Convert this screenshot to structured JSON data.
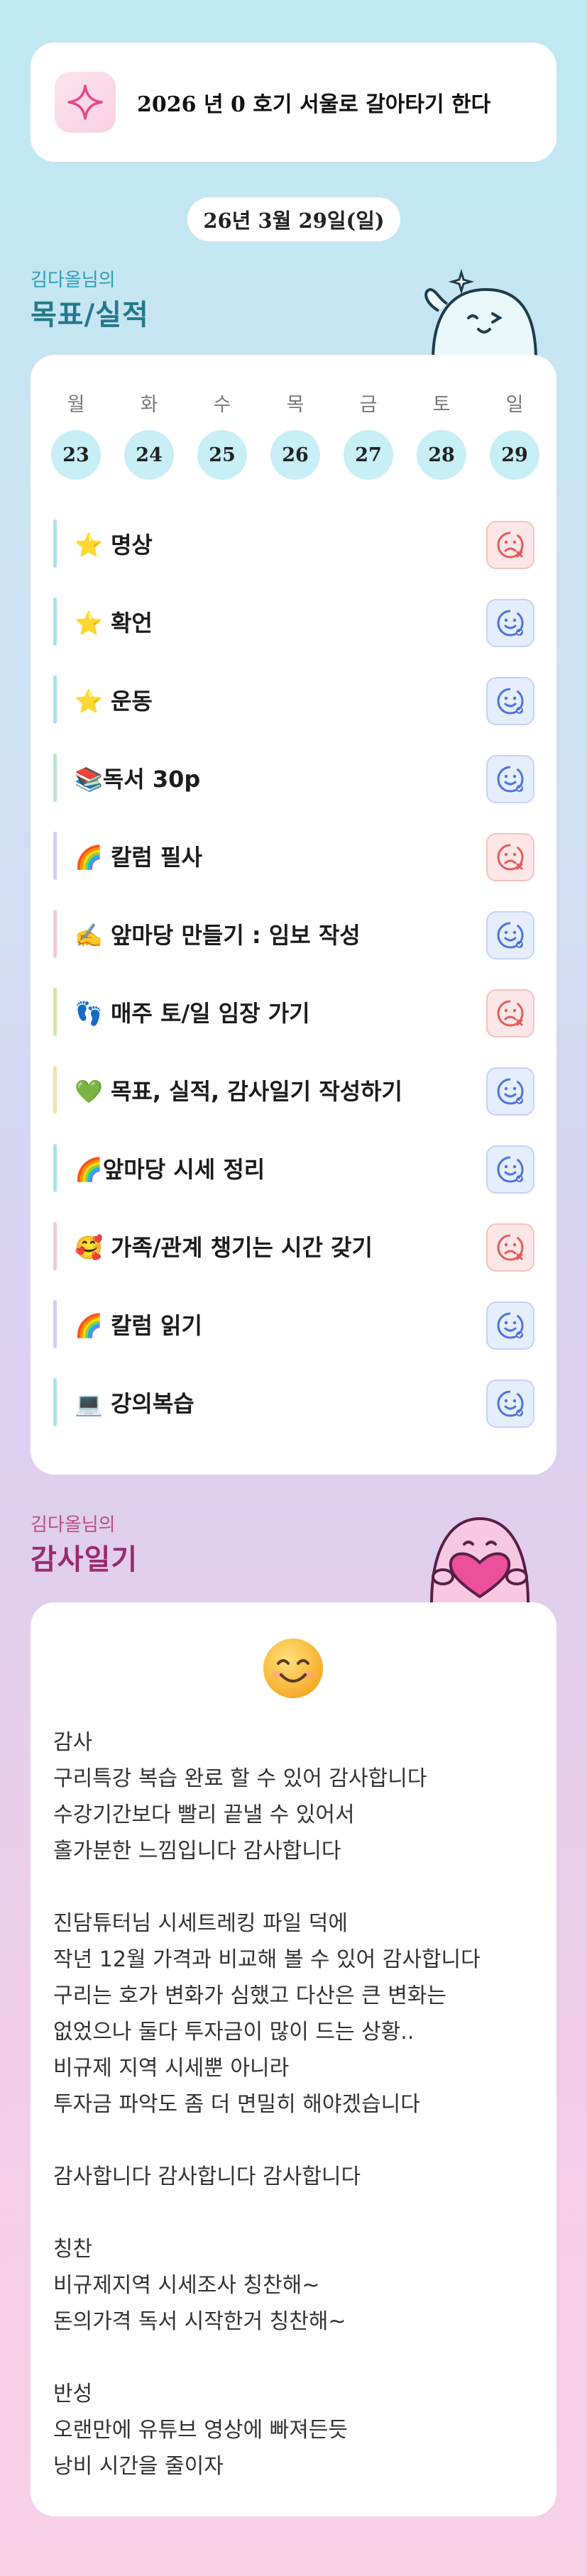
{
  "goal": {
    "text": "2026 년 0 호기 서울로 갈아타기 한다",
    "icon": "sparkle-icon"
  },
  "date_label": "26년 3월 29일(일)",
  "tracker": {
    "owner": "김다올님의",
    "title": "목표/실적",
    "days": [
      {
        "dow": "월",
        "num": "23"
      },
      {
        "dow": "화",
        "num": "24"
      },
      {
        "dow": "수",
        "num": "25"
      },
      {
        "dow": "목",
        "num": "26"
      },
      {
        "dow": "금",
        "num": "27"
      },
      {
        "dow": "토",
        "num": "28"
      },
      {
        "dow": "일",
        "num": "29"
      }
    ],
    "tasks": [
      {
        "label": "⭐ 명상",
        "status": "fail",
        "bar": "#a7e3f0"
      },
      {
        "label": "⭐ 확언",
        "status": "done",
        "bar": "#a7e3f0"
      },
      {
        "label": "⭐ 운동",
        "status": "done",
        "bar": "#a7e3f0"
      },
      {
        "label": "📚독서 30p",
        "status": "done",
        "bar": "#b9e8c8"
      },
      {
        "label": "🌈 칼럼 필사",
        "status": "fail",
        "bar": "#d4cdf5"
      },
      {
        "label": "✍️ 앞마당 만들기 : 임보 작성",
        "status": "done",
        "bar": "#f4c8d8"
      },
      {
        "label": "👣 매주 토/일 임장 가기",
        "status": "fail",
        "bar": "#cfe8a6"
      },
      {
        "label": "💚 목표, 실적, 감사일기 작성하기",
        "status": "done",
        "bar": "#f6e3a8"
      },
      {
        "label": "🌈앞마당 시세 정리",
        "status": "done",
        "bar": "#a7e3f0"
      },
      {
        "label": "🥰 가족/관계 챙기는 시간 갖기",
        "status": "fail",
        "bar": "#f4c8d8"
      },
      {
        "label": "🌈 칼럼 읽기",
        "status": "done",
        "bar": "#d4cdf5"
      },
      {
        "label": "💻 강의복습",
        "status": "done",
        "bar": "#a7e3f0"
      }
    ],
    "status_colors": {
      "done": "#4a73e0",
      "fail": "#e35b5b"
    }
  },
  "diary": {
    "owner": "김다올님의",
    "title": "감사일기",
    "emoji": "smiling-face-icon",
    "lines": [
      "감사",
      "구리특강 복습 완료 할 수 있어 감사합니다",
      "수강기간보다 빨리 끝낼 수 있어서",
      "홀가분한 느낌입니다 감사합니다",
      "",
      "진담튜터님 시세트레킹 파일 덕에",
      "작년 12월 가격과 비교해 볼 수 있어 감사합니다",
      "구리는 호가 변화가 심했고 다산은 큰 변화는",
      "없었으나 둘다 투자금이 많이 드는 상황..",
      "비규제 지역 시세뿐 아니라",
      "투자금 파악도 좀 더 면밀히 해야겠습니다",
      "",
      "감사합니다 감사합니다 감사합니다",
      "",
      "칭찬",
      "비규제지역 시세조사 칭찬해~",
      "돈의가격 독서 시작한거 칭찬해~",
      "",
      "반성",
      "오랜만에 유튜브 영상에 빠져든듯",
      "낭비 시간을 줄이자"
    ]
  }
}
